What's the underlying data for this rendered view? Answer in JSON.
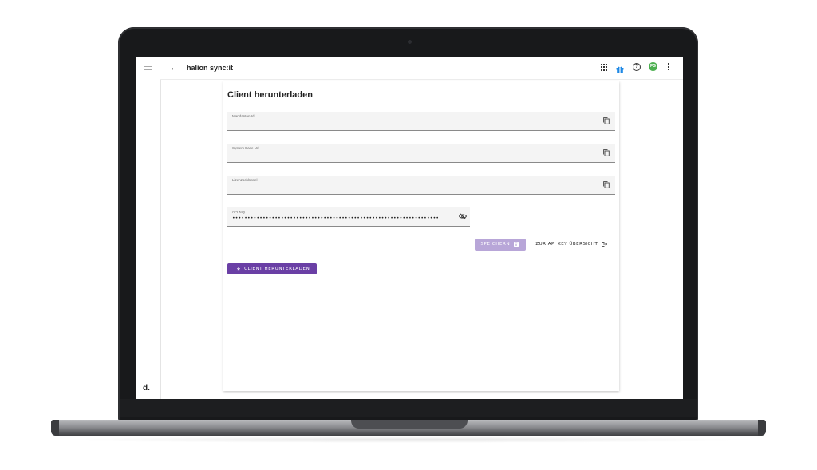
{
  "app": {
    "title": "halion sync:it",
    "sidebar_logo": "d.",
    "avatar_initials": "FG",
    "accent_color": "#6a3fa5",
    "avatar_color": "#4caf50"
  },
  "icons": {
    "menu": "hamburger-menu-icon",
    "back": "arrow-left-icon",
    "apps": "grid-apps-icon",
    "gift": "gift-icon",
    "help": "help-circle-icon",
    "more": "more-vertical-icon",
    "copy": "copy-icon",
    "eye_off": "eye-off-icon",
    "save": "floppy-disk-icon",
    "open": "external-link-icon",
    "download": "download-icon"
  },
  "page": {
    "title": "Client herunterladen",
    "fields": {
      "mandant": {
        "label": "Mandanten Id",
        "value": ""
      },
      "system_uri": {
        "label": "System Base Uri",
        "value": ""
      },
      "license": {
        "label": "Lizenzschlüssel",
        "value": ""
      },
      "api_key": {
        "label": "API Key",
        "value": "••••••••••••••••••••••••••••••••••••••••••••••••••••••••••••••••••••"
      }
    },
    "buttons": {
      "save": "SPEICHERN",
      "api_overview": "ZUR API KEY ÜBERSICHT",
      "download": "CLIENT HERUNTERLADEN"
    }
  }
}
